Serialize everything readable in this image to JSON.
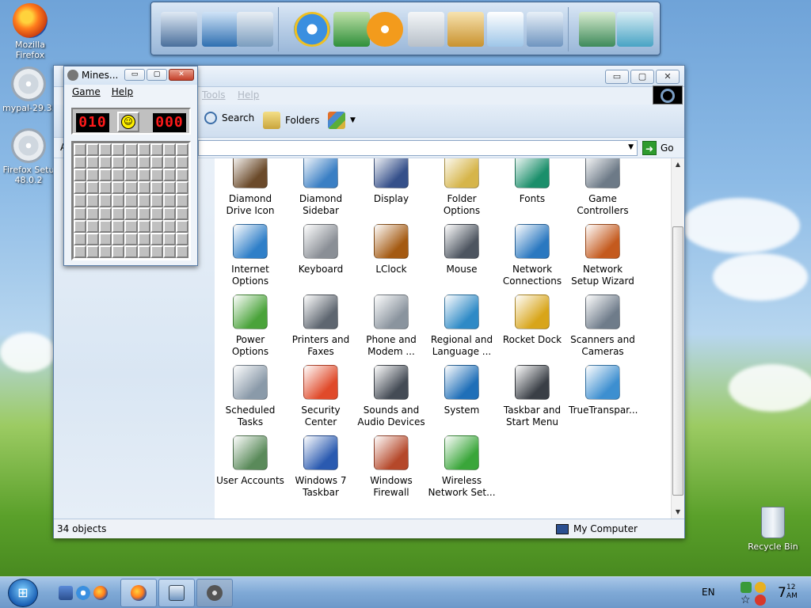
{
  "desktop": {
    "icons": [
      {
        "label": "Mozilla Firefox"
      },
      {
        "label": "mypal-29.3.",
        "label_partial": "mypal-29.3."
      },
      {
        "label": "Firefox Setu",
        "label2": "48.0.2"
      }
    ],
    "recycle_bin": "Recycle Bin"
  },
  "minesweeper": {
    "title": "Mines...",
    "menu": {
      "game": "Game",
      "help": "Help"
    },
    "mines_left": "010",
    "timer": "000",
    "grid_size": 9,
    "smiley": "☺"
  },
  "explorer": {
    "menu": {
      "tools": "Tools",
      "help": "Help"
    },
    "toolbar": {
      "search": "Search",
      "folders": "Folders"
    },
    "address": {
      "value": "",
      "go": "Go",
      "left_char": "A"
    },
    "status": {
      "objects": "34 objects",
      "location": "My Computer"
    },
    "window_buttons": {
      "minimize": "▭",
      "maximize": "▢",
      "close": "✕"
    },
    "items": [
      {
        "label": "Diamond Drive Icon",
        "icon": "hard-drive-icon",
        "color": "#6b4a2a"
      },
      {
        "label": "Diamond Sidebar",
        "icon": "monitor-icon",
        "color": "#3a7fc4"
      },
      {
        "label": "Display",
        "icon": "display-icon",
        "color": "#35508a"
      },
      {
        "label": "Folder Options",
        "icon": "folder-options-icon",
        "color": "#d6b54a"
      },
      {
        "label": "Fonts",
        "icon": "fonts-icon",
        "color": "#1b8f6b"
      },
      {
        "label": "Game Controllers",
        "icon": "gamepad-icon",
        "color": "#6d7a87"
      },
      {
        "label": "Internet Options",
        "icon": "globe-icon",
        "color": "#2f7fc8"
      },
      {
        "label": "Keyboard",
        "icon": "keyboard-icon",
        "color": "#8a8f96"
      },
      {
        "label": "LClock",
        "icon": "clock-icon",
        "color": "#a45a12"
      },
      {
        "label": "Mouse",
        "icon": "mouse-icon",
        "color": "#4d5560"
      },
      {
        "label": "Network Connections",
        "icon": "network-icon",
        "color": "#2a78c0"
      },
      {
        "label": "Network Setup Wizard",
        "icon": "house-icon",
        "color": "#c45a1e"
      },
      {
        "label": "Power Options",
        "icon": "battery-icon",
        "color": "#4aa33a"
      },
      {
        "label": "Printers and Faxes",
        "icon": "printer-icon",
        "color": "#5e6670"
      },
      {
        "label": "Phone and Modem ...",
        "icon": "phone-icon",
        "color": "#8a949e"
      },
      {
        "label": "Regional and Language ...",
        "icon": "regional-globe-icon",
        "color": "#2f8ac6"
      },
      {
        "label": "Rocket Dock",
        "icon": "rocketdock-icon",
        "color": "#d8a51a"
      },
      {
        "label": "Scanners and Cameras",
        "icon": "scanner-icon",
        "color": "#6f7c8a"
      },
      {
        "label": "Scheduled Tasks",
        "icon": "tasks-clock-icon",
        "color": "#8a9aa9"
      },
      {
        "label": "Security Center",
        "icon": "shield-icon",
        "color": "#e04a2a"
      },
      {
        "label": "Sounds and Audio Devices",
        "icon": "speaker-icon",
        "color": "#444b55"
      },
      {
        "label": "System",
        "icon": "system-monitor-icon",
        "color": "#1f6fb8"
      },
      {
        "label": "Taskbar and Start Menu",
        "icon": "taskbar-icon",
        "color": "#3a3f46"
      },
      {
        "label": "TrueTranspar...",
        "icon": "truetransparency-icon",
        "color": "#3d8fd0"
      },
      {
        "label": "User Accounts",
        "icon": "users-icon",
        "color": "#5a8a5a"
      },
      {
        "label": "Windows 7 Taskbar",
        "icon": "win7-taskbar-icon",
        "color": "#2a5ab0"
      },
      {
        "label": "Windows Firewall",
        "icon": "firewall-icon",
        "color": "#b5482a"
      },
      {
        "label": "Wireless Network Set...",
        "icon": "wireless-icon",
        "color": "#3aa63a"
      }
    ]
  },
  "taskbar": {
    "start": "⊞",
    "language": "EN",
    "clock_hour": "7",
    "clock_min": "12",
    "clock_ampm": "AM"
  }
}
